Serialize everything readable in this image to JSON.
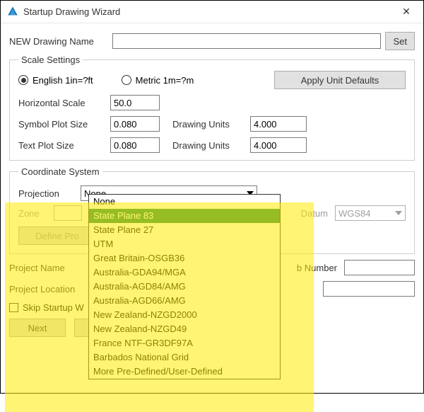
{
  "window": {
    "title": "Startup Drawing Wizard",
    "close_glyph": "✕"
  },
  "drawing_name": {
    "label": "NEW Drawing Name",
    "value": "",
    "set_button": "Set"
  },
  "scale_settings": {
    "legend": "Scale Settings",
    "radio_english": "English 1in=?ft",
    "radio_metric": "Metric 1m=?m",
    "apply_defaults": "Apply Unit Defaults",
    "horizontal_scale_label": "Horizontal Scale",
    "horizontal_scale_value": "50.0",
    "symbol_plot_label": "Symbol Plot Size",
    "symbol_plot_value": "0.080",
    "symbol_units_label": "Drawing Units",
    "symbol_units_value": "4.000",
    "text_plot_label": "Text Plot Size",
    "text_plot_value": "0.080",
    "text_units_label": "Drawing Units",
    "text_units_value": "4.000"
  },
  "coord": {
    "legend": "Coordinate System",
    "projection_label": "Projection",
    "projection_value": "None",
    "zone_label": "Zone",
    "zone_value": "",
    "datum_label": "Datum",
    "datum_value": "WGS84",
    "define_button": "Define Pro"
  },
  "projection_options": [
    "None",
    "State Plane 83",
    "State Plane 27",
    "UTM",
    "Great Britain-OSGB36",
    "Australia-GDA94/MGA",
    "Australia-AGD84/AMG",
    "Australia-AGD66/AMG",
    "New Zealand-NZGD2000",
    "New Zealand-NZGD49",
    "France NTF-GR3DF97A",
    "Barbados National Grid",
    "More Pre-Defined/User-Defined"
  ],
  "projection_selected_index": 1,
  "project": {
    "name_label": "Project Name",
    "name_value": "",
    "job_label": "b Number",
    "job_value": "",
    "location_label": "Project Location",
    "location_value": ""
  },
  "footer": {
    "skip_label": "Skip Startup W",
    "next": "Next",
    "exit_partial": ""
  }
}
